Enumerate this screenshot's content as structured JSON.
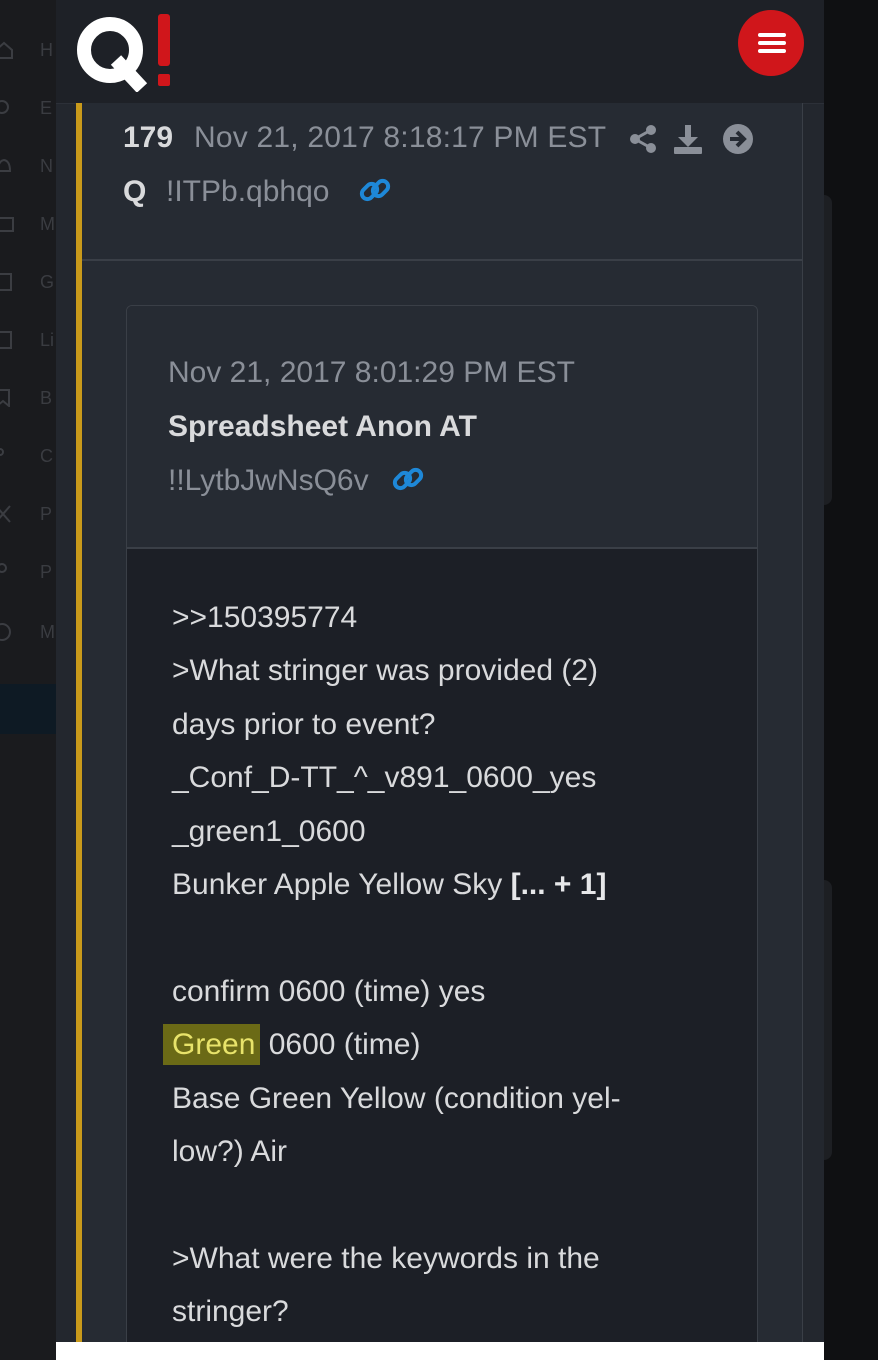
{
  "header": {
    "logo_text": "Q!",
    "menu_label": "Menu"
  },
  "background": {
    "sidebar_labels": [
      "H",
      "E",
      "N",
      "M",
      "G",
      "Li",
      "B",
      "C",
      "P",
      "P",
      "M"
    ]
  },
  "post": {
    "number": "179",
    "date": "Nov 21, 2017 8:18:17 PM EST",
    "author": "Q",
    "tripcode": "!ITPb.qbhqo",
    "quoted": {
      "date": "Nov 21, 2017 8:01:29 PM EST",
      "author": "Spreadsheet Anon AT",
      "tripcode": "!!LytbJwNsQ6v"
    },
    "body": {
      "line1": ">>150395774",
      "line2": ">What stringer was provided (2)",
      "line3": "days prior to event?",
      "line4": "_Conf_D-TT_^_v891_0600_yes",
      "line5": "_green1_0600",
      "line6": "Bunker Apple Yellow Sky",
      "more": "[... + 1]",
      "line7": "confirm 0600 (time) yes",
      "highlight": "Green",
      "line8_rest": " 0600 (time)",
      "line9": "Base Green Yellow (condition yel-",
      "line10": "low?) Air",
      "line11": ">What were the keywords in the",
      "line12": "stringer?"
    }
  },
  "colors": {
    "accent_bar": "#c99a1b",
    "brand_red": "#d0161b",
    "link_blue": "#1e88d8",
    "highlight_bg": "#6b6a16"
  }
}
